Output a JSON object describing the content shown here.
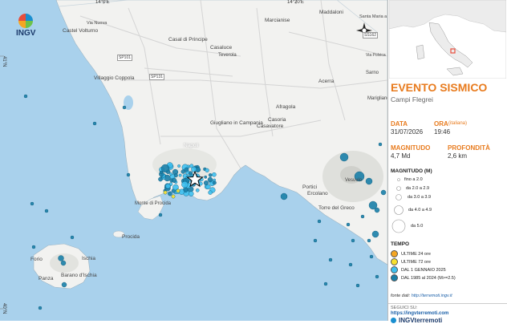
{
  "logo": {
    "text": "INGV"
  },
  "coords": {
    "lon1": "14°0'E",
    "lon2": "14°20'E",
    "lat1": "41°N",
    "lat2": "40°N"
  },
  "places": [
    {
      "n": "Castel Volturno",
      "id": "castel-volturno"
    },
    {
      "n": "Marcianise",
      "id": "marcianise"
    },
    {
      "n": "Maddaloni",
      "id": "maddaloni"
    },
    {
      "n": "Santa Maria a Vico",
      "id": "santa-maria"
    },
    {
      "n": "Casal di Principe",
      "id": "casal-di-principe"
    },
    {
      "n": "Casaluce",
      "id": "casaluce"
    },
    {
      "n": "Teverola",
      "id": "teverola"
    },
    {
      "n": "Villaggio Coppola",
      "id": "villaggio-coppola"
    },
    {
      "n": "Acerra",
      "id": "acerra"
    },
    {
      "n": "Marigliano",
      "id": "marigliano"
    },
    {
      "n": "Afragola",
      "id": "afragola"
    },
    {
      "n": "Casoria",
      "id": "casoria"
    },
    {
      "n": "Casavatore",
      "id": "casavatore"
    },
    {
      "n": "Giugliano in Campania",
      "id": "giugliano"
    },
    {
      "n": "Napoli",
      "id": "napoli"
    },
    {
      "n": "Portici",
      "id": "portici"
    },
    {
      "n": "Ercolano",
      "id": "ercolano"
    },
    {
      "n": "Torre del Greco",
      "id": "torre-del-greco"
    },
    {
      "n": "Monte di Procida",
      "id": "monte-di-procida"
    },
    {
      "n": "Procida",
      "id": "procida"
    },
    {
      "n": "Forio",
      "id": "forio"
    },
    {
      "n": "Ischia",
      "id": "ischia"
    },
    {
      "n": "Barano d'Ischia",
      "id": "barano"
    },
    {
      "n": "Panza",
      "id": "panza"
    },
    {
      "n": "Sarno",
      "id": "sarno"
    },
    {
      "n": "Vesuvio",
      "id": "vesuvio"
    },
    {
      "n": "Via Nuova",
      "id": "via-nuova"
    },
    {
      "n": "SP101",
      "id": "sp101"
    },
    {
      "n": "SP131",
      "id": "sp131"
    },
    {
      "n": "SS162",
      "id": "ss162"
    },
    {
      "n": "Via Polvica",
      "id": "via-polvica"
    }
  ],
  "event": {
    "title": "EVENTO SISMICO",
    "area": "Campi Flegrei",
    "date_label": "DATA",
    "date": "31/07/2026",
    "time_label": "ORA",
    "time_note": "(italiana)",
    "time": "19:46",
    "mag_label": "MAGNITUDO",
    "mag": "4,7 Md",
    "depth_label": "PROFONDITÀ",
    "depth": "2,6 km"
  },
  "legend": {
    "mag_title": "MAGNITUDO (M)",
    "mag_items": [
      "fino a 2.0",
      "da 2.0 a 2.9",
      "da 3.0 a 3.9",
      "da 4.0 a 4.9",
      "da 5.0"
    ],
    "time_title": "TEMPO",
    "time_items": [
      {
        "label": "ULTIME 24 ore",
        "color": "#f5a623"
      },
      {
        "label": "ULTIME 72 ore",
        "color": "#f7e02e"
      },
      {
        "label": "DAL 1 GENNAIO 2025",
        "color": "#3ec0ef"
      },
      {
        "label": "DAL 1985 al 2024 (M>=2.5)",
        "color": "#1a7fa8"
      }
    ],
    "source_label": "fonte dati:",
    "source_url": "http://terremoti.ingv.it"
  },
  "social": {
    "follow": "SEGUICI SU:",
    "url": "https://ingvterremoti.com",
    "brand": "INGVterremoti"
  },
  "colors": {
    "sea": "#a9d1ec",
    "land": "#f2f2f0",
    "accent": "#e87b1e",
    "star": "#ffffff"
  }
}
